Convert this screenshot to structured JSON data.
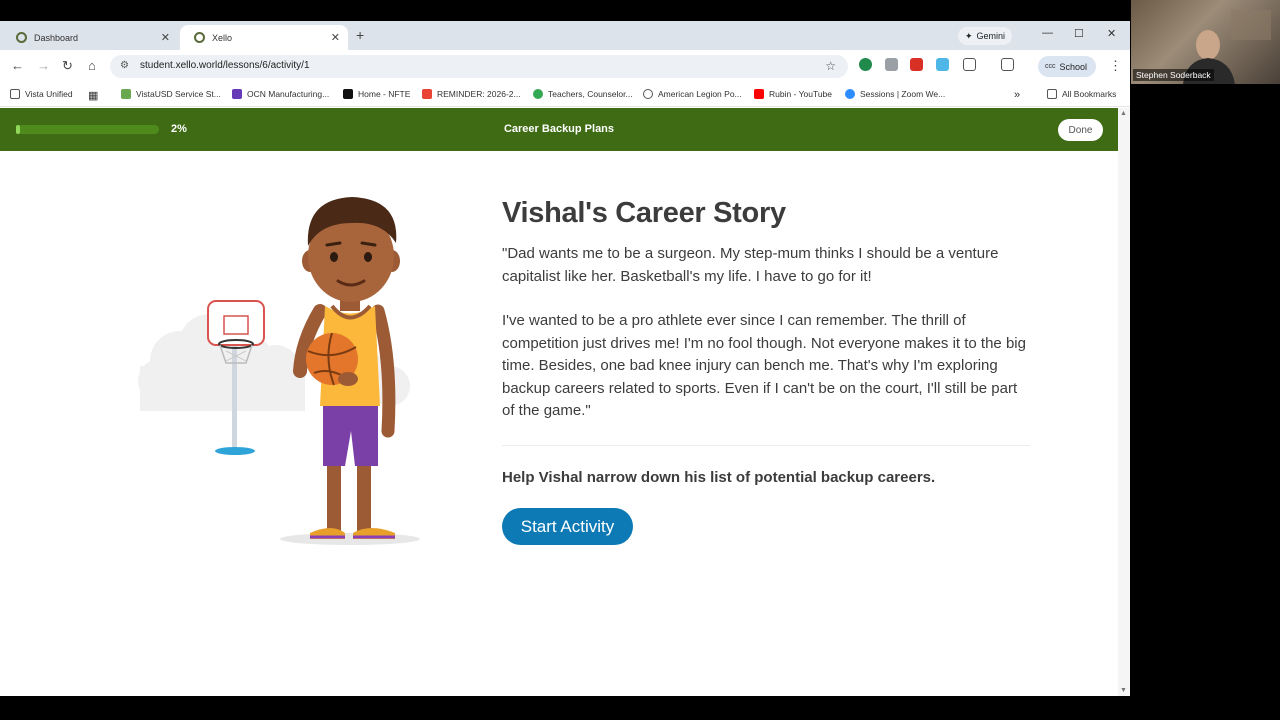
{
  "browser": {
    "tabs": [
      {
        "title": "Dashboard",
        "active": false
      },
      {
        "title": "Xello",
        "active": true
      }
    ],
    "gemini_label": "Gemini",
    "url": "student.xello.world/lessons/6/activity/1",
    "profile_label": "School",
    "profile_badge": "ccc",
    "bookmarks": [
      "Vista Unified",
      "VistaUSD Service St...",
      "OCN Manufacturing...",
      "Home - NFTE",
      "REMINDER: 2026-2...",
      "Teachers, Counselor...",
      "American Legion Po...",
      "Rubin - YouTube",
      "Sessions | Zoom We..."
    ],
    "bookmarks_overflow": "»",
    "all_bookmarks": "All Bookmarks"
  },
  "app": {
    "progress_percent": 2,
    "progress_label": "2%",
    "lesson_title": "Career Backup Plans",
    "done_label": "Done"
  },
  "story": {
    "title": "Vishal's Career Story",
    "paragraph1": "\"Dad wants me to be a surgeon. My step-mum thinks I should be a venture capitalist like her. Basketball's my life. I have to go for it!",
    "paragraph2": "I've wanted to be a pro athlete ever since I can remember. The thrill of competition just drives me! I'm no fool though. Not everyone makes it to the big time. Besides, one bad knee injury can bench me. That's why I'm exploring backup careers related to sports. Even if I can't be on the court, I'll still be part of the game.\"",
    "prompt": "Help Vishal narrow down his list of potential backup careers.",
    "start_label": "Start Activity"
  },
  "webcam": {
    "participant_name": "Stephen Soderback"
  },
  "colors": {
    "header_green": "#3e6b14",
    "button_blue": "#0d7ab5",
    "jersey_yellow": "#fbb83a",
    "shorts_purple": "#7b3fa8"
  }
}
